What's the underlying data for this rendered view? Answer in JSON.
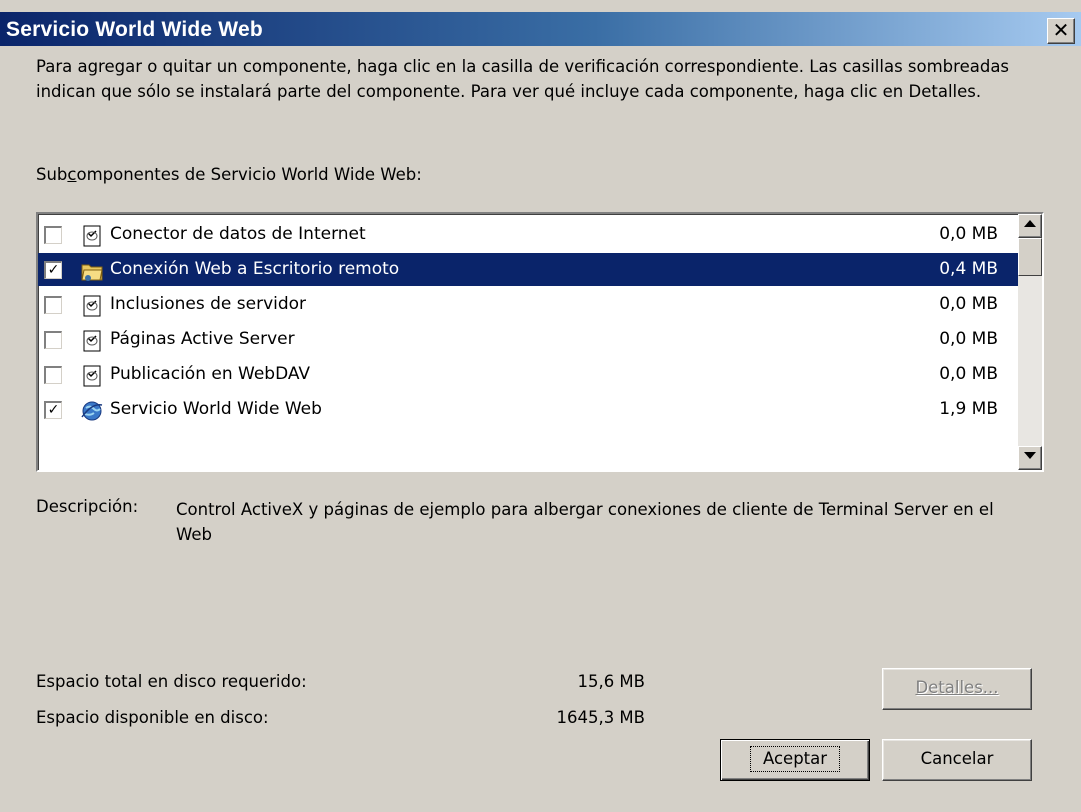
{
  "window": {
    "title": "Servicio World Wide Web",
    "close_glyph": "✕"
  },
  "instructions": "Para agregar o quitar un componente, haga clic en la casilla de verificación correspondiente. Las casillas sombreadas indican que sólo se instalará parte del componente. Para ver qué incluye cada componente, haga clic en Detalles.",
  "subcomponents_label": {
    "prefix": "Sub",
    "accel": "c",
    "suffix": "omponentes de Servicio World Wide Web:"
  },
  "components": [
    {
      "name": "Conector de datos de Internet",
      "size": "0,0 MB",
      "checked": false,
      "selected": false,
      "icon": "file-component-icon"
    },
    {
      "name": "Conexión Web a Escritorio remoto",
      "size": "0,4 MB",
      "checked": true,
      "selected": true,
      "icon": "folder-component-icon"
    },
    {
      "name": "Inclusiones de servidor",
      "size": "0,0 MB",
      "checked": false,
      "selected": false,
      "icon": "file-component-icon"
    },
    {
      "name": "Páginas Active Server",
      "size": "0,0 MB",
      "checked": false,
      "selected": false,
      "icon": "file-component-icon"
    },
    {
      "name": "Publicación en WebDAV",
      "size": "0,0 MB",
      "checked": false,
      "selected": false,
      "icon": "file-component-icon"
    },
    {
      "name": "Servicio World Wide Web",
      "size": "1,9 MB",
      "checked": true,
      "selected": false,
      "icon": "globe-component-icon"
    }
  ],
  "description": {
    "label": "Descripción:",
    "text": "Control ActiveX y páginas de ejemplo para albergar conexiones de cliente de Terminal Server en el Web"
  },
  "disk": {
    "required_label": "Espacio total en disco requerido:",
    "required_value": "15,6 MB",
    "available_label": "Espacio disponible en disco:",
    "available_value": "1645,3 MB"
  },
  "buttons": {
    "details": "Detalles...",
    "ok": "Aceptar",
    "cancel": "Cancelar"
  },
  "colors": {
    "titlebar_start": "#0a246a",
    "titlebar_end": "#a6caf0",
    "selection": "#0a246a",
    "face": "#d4d0c8"
  }
}
